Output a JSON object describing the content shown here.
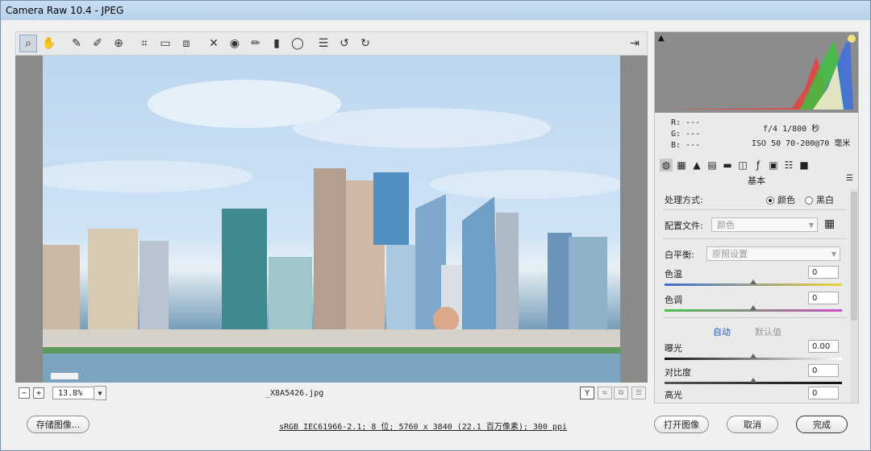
{
  "window": {
    "title": "Camera Raw 10.4 - JPEG"
  },
  "toolbar": {
    "tools": [
      {
        "icon": "zoom-icon",
        "glyph": "⌕"
      },
      {
        "icon": "hand-icon",
        "glyph": "✋"
      },
      {
        "icon": "white-balance-icon",
        "glyph": "✎"
      },
      {
        "icon": "color-sampler-icon",
        "glyph": "✐"
      },
      {
        "icon": "targeted-adjust-icon",
        "glyph": "⊕"
      },
      {
        "icon": "crop-icon",
        "glyph": "⌗"
      },
      {
        "icon": "straighten-icon",
        "glyph": "▭"
      },
      {
        "icon": "transform-icon",
        "glyph": "⧈"
      },
      {
        "icon": "spot-removal-icon",
        "glyph": "✕"
      },
      {
        "icon": "red-eye-icon",
        "glyph": "◉"
      },
      {
        "icon": "adjustment-brush-icon",
        "glyph": "✏"
      },
      {
        "icon": "graduated-filter-icon",
        "glyph": "▮"
      },
      {
        "icon": "radial-filter-icon",
        "glyph": "◯"
      },
      {
        "icon": "preferences-icon",
        "glyph": "☰"
      },
      {
        "icon": "rotate-left-icon",
        "glyph": "↺"
      },
      {
        "icon": "rotate-right-icon",
        "glyph": "↻"
      }
    ],
    "fullscreen_glyph": "⇥"
  },
  "status": {
    "minus": "−",
    "plus": "+",
    "zoom": "13.8%",
    "filename": "_X8A5426.jpg",
    "view_y": "Y"
  },
  "info": {
    "r": "R:  ---",
    "g": "G:  ---",
    "b": "B:  ---",
    "exif_line1": "f/4   1/800 秒",
    "exif_line2": "ISO 50   70-200@70 毫米"
  },
  "panel": {
    "title": "基本",
    "treatment_label": "处理方式:",
    "treatment_color": "颜色",
    "treatment_bw": "黑白",
    "profile_label": "配置文件:",
    "profile_value": "颜色",
    "wb_label": "白平衡:",
    "wb_value": "原照设置",
    "temp_label": "色温",
    "temp_value": "0",
    "tint_label": "色调",
    "tint_value": "0",
    "auto": "自动",
    "default": "默认值",
    "exposure_label": "曝光",
    "exposure_value": "0.00",
    "contrast_label": "对比度",
    "contrast_value": "0",
    "highlights_label": "高光",
    "highlights_value": "0"
  },
  "footer": {
    "save": "存储图像...",
    "workflow": "sRGB IEC61966-2.1; 8 位; 5760 x 3840 (22.1 百万像素); 300 ppi",
    "open": "打开图像",
    "cancel": "取消",
    "done": "完成"
  }
}
